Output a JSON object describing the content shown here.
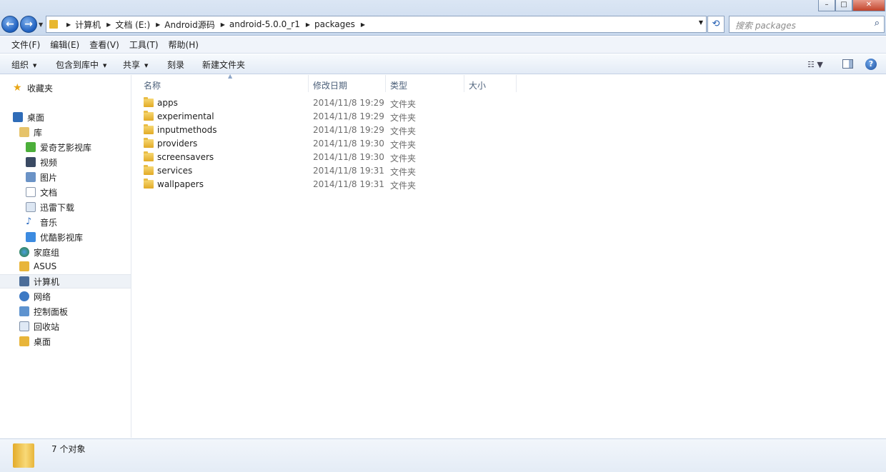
{
  "window": {
    "minimize": "–",
    "maximize": "□",
    "close": "✕"
  },
  "address": {
    "crumbs": [
      "计算机",
      "文档 (E:)",
      "Android源码",
      "android-5.0.0_r1",
      "packages"
    ]
  },
  "search": {
    "placeholder": "搜索 packages"
  },
  "menu": [
    "文件(F)",
    "编辑(E)",
    "查看(V)",
    "工具(T)",
    "帮助(H)"
  ],
  "commands": {
    "organize": "组织",
    "include_library": "包含到库中",
    "share": "共享",
    "burn": "刻录",
    "new_folder": "新建文件夹"
  },
  "nav": {
    "favorites": "收藏夹",
    "desktop": "桌面",
    "libraries": "库",
    "lib_items": [
      "爱奇艺影视库",
      "视频",
      "图片",
      "文档",
      "迅雷下载",
      "音乐",
      "优酷影视库"
    ],
    "homegroup": "家庭组",
    "asus": "ASUS",
    "computer": "计算机",
    "network": "网络",
    "control_panel": "控制面板",
    "recycle_bin": "回收站",
    "desktop2": "桌面"
  },
  "columns": {
    "name": "名称",
    "modified": "修改日期",
    "type": "类型",
    "size": "大小"
  },
  "files": [
    {
      "name": "apps",
      "modified": "2014/11/8 19:29",
      "type": "文件夹"
    },
    {
      "name": "experimental",
      "modified": "2014/11/8 19:29",
      "type": "文件夹"
    },
    {
      "name": "inputmethods",
      "modified": "2014/11/8 19:29",
      "type": "文件夹"
    },
    {
      "name": "providers",
      "modified": "2014/11/8 19:30",
      "type": "文件夹"
    },
    {
      "name": "screensavers",
      "modified": "2014/11/8 19:30",
      "type": "文件夹"
    },
    {
      "name": "services",
      "modified": "2014/11/8 19:31",
      "type": "文件夹"
    },
    {
      "name": "wallpapers",
      "modified": "2014/11/8 19:31",
      "type": "文件夹"
    }
  ],
  "status": {
    "count_text": "7 个对象"
  },
  "icons": {
    "back": "back-arrow-icon",
    "forward": "forward-arrow-icon",
    "refresh": "refresh-icon",
    "search": "search-icon",
    "folder": "folder-icon",
    "help": "help-icon"
  }
}
